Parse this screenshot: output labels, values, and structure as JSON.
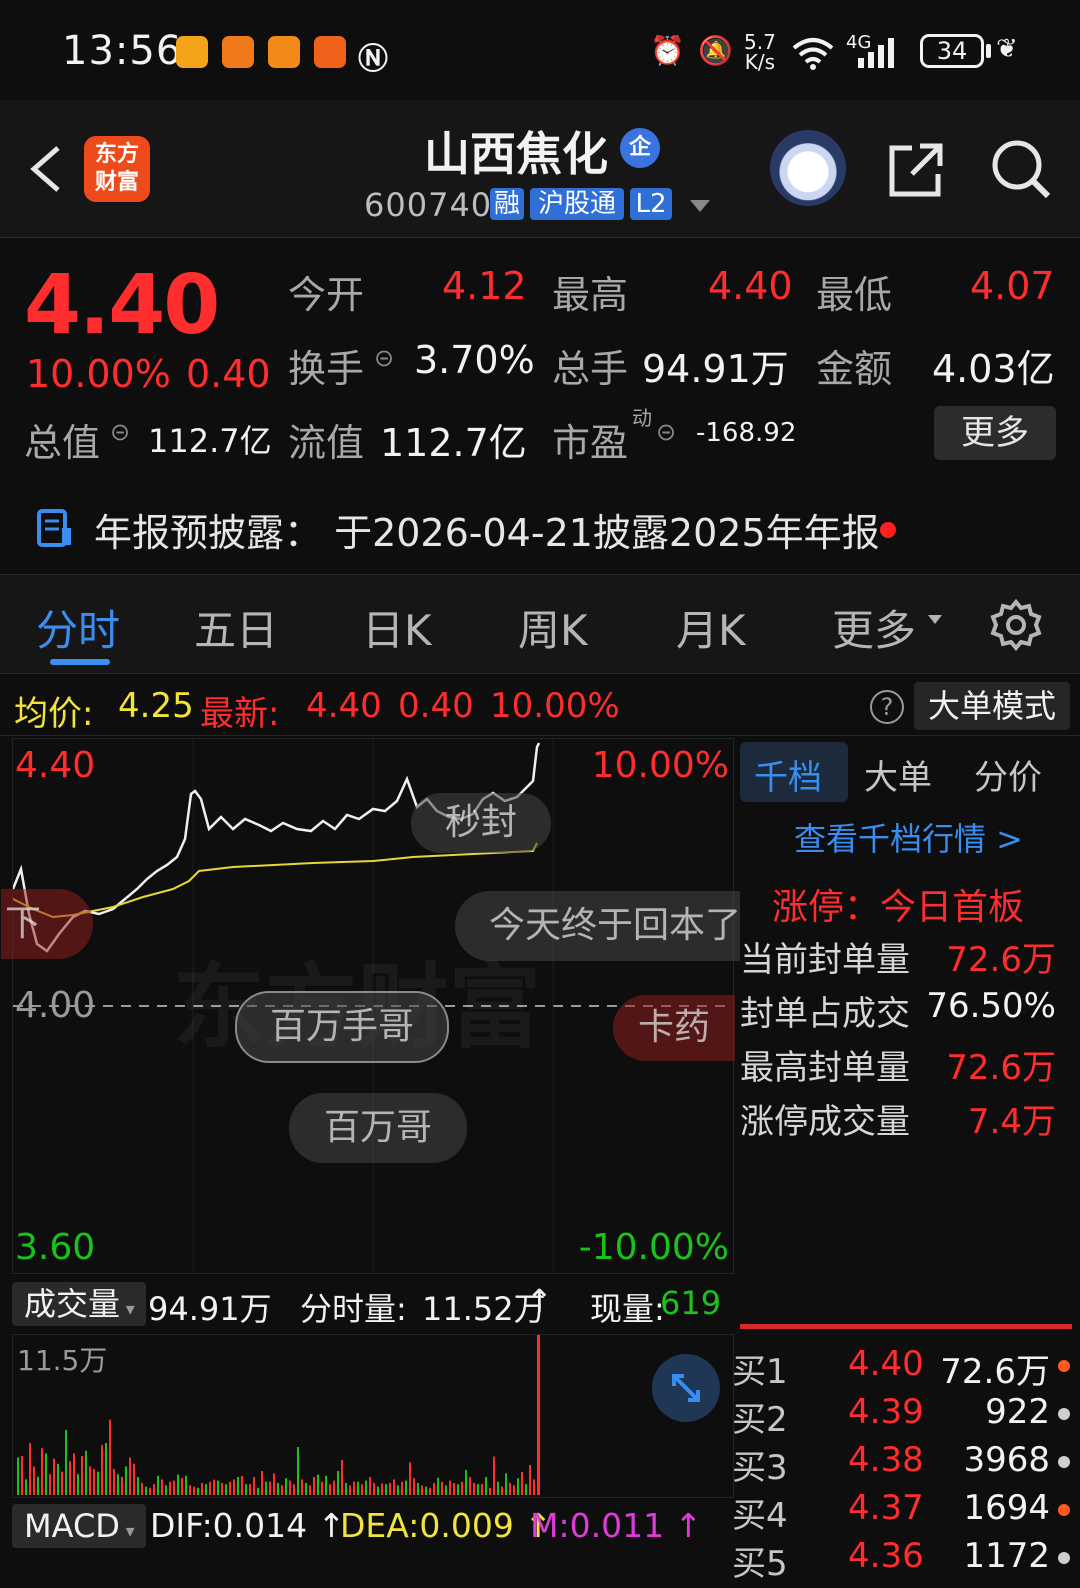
{
  "status": {
    "time": "13:56",
    "net_speed_top": "5.7",
    "net_speed_bottom": "K/s",
    "signal": "4G",
    "battery": "34"
  },
  "header": {
    "logo_line1": "东方",
    "logo_line2": "财富",
    "name": "山西焦化",
    "qi": "企",
    "code": "600740",
    "tags": [
      "融",
      "沪股通",
      "L2"
    ]
  },
  "quote": {
    "price": "4.40",
    "pct": "10.00%",
    "chg": "0.40",
    "open_label": "今开",
    "open": "4.12",
    "high_label": "最高",
    "high": "4.40",
    "low_label": "最低",
    "low": "4.07",
    "turnover_label": "换手",
    "turnover": "3.70%",
    "volume_label": "总手",
    "volume": "94.91万",
    "amount_label": "金额",
    "amount": "4.03亿",
    "mktcap_label": "总值",
    "mktcap": "112.7亿",
    "float_label": "流值",
    "float": "112.7亿",
    "pe_label": "市盈",
    "pe_sup": "动",
    "pe": "-168.92",
    "more": "更多"
  },
  "notice": {
    "text": "年报预披露：  于2026-04-21披露2025年年报"
  },
  "tabs": [
    "分时",
    "五日",
    "日K",
    "周K",
    "月K",
    "更多"
  ],
  "infobar": {
    "avg_label": "均价:",
    "avg": "4.25",
    "latest_label": "最新:",
    "latest": "4.40",
    "chg": "0.40",
    "pct": "10.00%",
    "help": "?",
    "mode_button": "大单模式"
  },
  "chart": {
    "y_top": "4.40",
    "y_mid": "4.00",
    "y_bottom": "3.60",
    "pct_top": "10.00%",
    "pct_bottom": "-10.00%",
    "bubbles": [
      "秒封",
      "今天终于回本了",
      "百万手哥",
      "卡药",
      "百万哥",
      "下"
    ],
    "watermark": "东方财富"
  },
  "volume": {
    "dropdown": "成交量",
    "total": "94.91万",
    "period_label": "分时量:",
    "period": "11.52万",
    "now_label": "现量:",
    "now": "619",
    "max": "11.5万"
  },
  "macd": {
    "dropdown": "MACD",
    "dif": "DIF:0.014",
    "dea": "DEA:0.009",
    "m": "M:0.011"
  },
  "rpanel": {
    "tabs": [
      "千档",
      "大单",
      "分价"
    ],
    "view_link": "查看千档行情 >",
    "limit_title": "涨停：今日首板",
    "rows": [
      {
        "label": "当前封单量",
        "value": "72.6万",
        "color": "#ff2d2d"
      },
      {
        "label": "封单占成交",
        "value": "76.50%",
        "color": "#f2f2f2"
      },
      {
        "label": "最高封单量",
        "value": "72.6万",
        "color": "#ff2d2d"
      },
      {
        "label": "涨停成交量",
        "value": "7.4万",
        "color": "#ff2d2d"
      }
    ],
    "orderbook": [
      {
        "label": "买1",
        "price": "4.40",
        "vol": "72.6万",
        "dot": "#ff5a1f"
      },
      {
        "label": "买2",
        "price": "4.39",
        "vol": "922",
        "dot": "#cfcfcf"
      },
      {
        "label": "买3",
        "price": "4.38",
        "vol": "3968",
        "dot": "#cfcfcf"
      },
      {
        "label": "买4",
        "price": "4.37",
        "vol": "1694",
        "dot": "#ff5a1f"
      },
      {
        "label": "买5",
        "price": "4.36",
        "vol": "1172",
        "dot": "#cfcfcf"
      }
    ]
  }
}
